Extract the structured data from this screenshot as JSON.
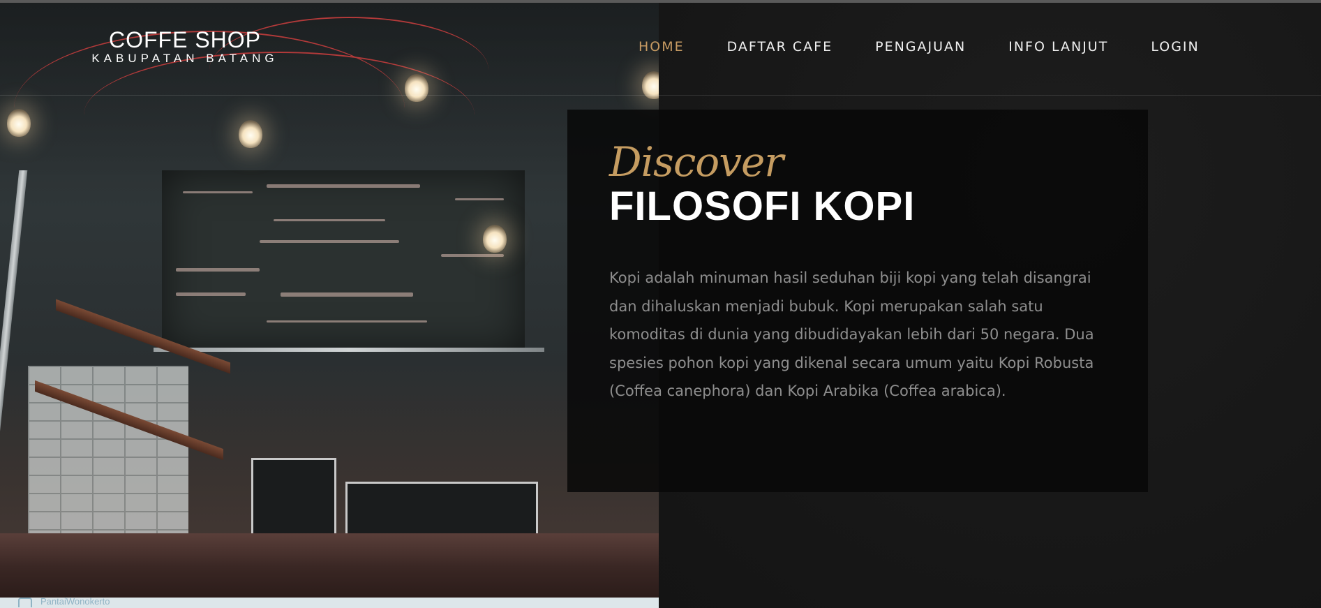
{
  "brand": {
    "title": "COFFE SHOP",
    "subtitle": "KABUPATAN BATANG"
  },
  "nav": {
    "items": [
      {
        "label": "HOME",
        "active": true
      },
      {
        "label": "DAFTAR CAFE",
        "active": false
      },
      {
        "label": "PENGAJUAN",
        "active": false
      },
      {
        "label": "INFO LANJUT",
        "active": false
      },
      {
        "label": "LOGIN",
        "active": false
      }
    ]
  },
  "hero": {
    "kicker": "Discover",
    "title": "FILOSOFI KOPI",
    "description": "Kopi adalah minuman hasil seduhan biji kopi yang telah disangrai dan dihaluskan menjadi bubuk. Kopi merupakan salah satu komoditas di dunia yang dibudidayakan lebih dari 50 negara. Dua spesies pohon kopi yang dikenal secara umum yaitu Kopi Robusta (Coffea canephora) dan Kopi Arabika (Coffea arabica)."
  },
  "footer_strip": {
    "text": "PantaiWonokerto"
  },
  "colors": {
    "accent": "#c59c61",
    "nav_active": "#c79b63",
    "background": "#141414",
    "text_muted": "#8e8e8e"
  }
}
